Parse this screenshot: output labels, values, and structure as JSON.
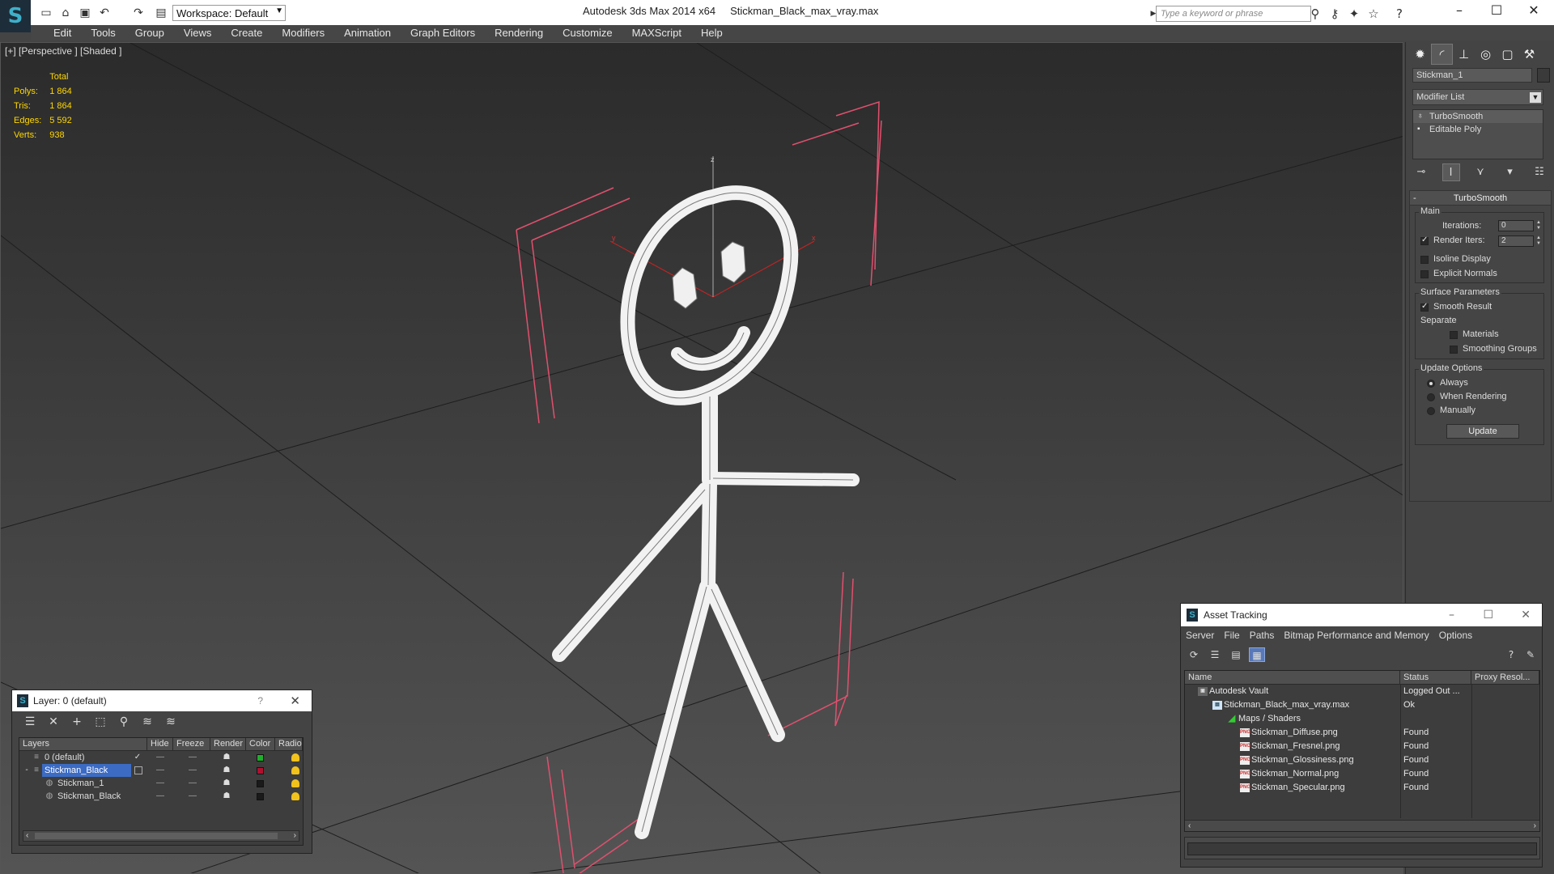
{
  "titlebar": {
    "workspace": "Workspace: Default",
    "app_title": "Autodesk 3ds Max  2014 x64",
    "file_name": "Stickman_Black_max_vray.max",
    "search_placeholder": "Type a keyword or phrase"
  },
  "menu": [
    "Edit",
    "Tools",
    "Group",
    "Views",
    "Create",
    "Modifiers",
    "Animation",
    "Graph Editors",
    "Rendering",
    "Customize",
    "MAXScript",
    "Help"
  ],
  "viewport": {
    "label": "[+] [Perspective ] [Shaded ]",
    "stats_header": "Total",
    "stats": [
      {
        "label": "Polys:",
        "value": "1 864"
      },
      {
        "label": "Tris:",
        "value": "1 864"
      },
      {
        "label": "Edges:",
        "value": "5 592"
      },
      {
        "label": "Verts:",
        "value": "938"
      }
    ],
    "gizmo": {
      "x": "x",
      "y": "y",
      "z": "z"
    }
  },
  "command_panel": {
    "object_name": "Stickman_1",
    "modifier_list": "Modifier List",
    "stack": [
      {
        "label": "TurboSmooth",
        "selected": true
      },
      {
        "label": "Editable Poly",
        "selected": false
      }
    ],
    "turbosmooth": {
      "title": "TurboSmooth",
      "main_group": "Main",
      "iterations_label": "Iterations:",
      "iterations_value": "0",
      "render_iters_label": "Render Iters:",
      "render_iters_value": "2",
      "render_iters_checked": true,
      "isoline_label": "Isoline Display",
      "isoline_checked": false,
      "explicit_normals_label": "Explicit Normals",
      "explicit_normals_checked": false,
      "surface_group": "Surface Parameters",
      "smooth_result_label": "Smooth Result",
      "smooth_result_checked": true,
      "separate_label": "Separate",
      "materials_label": "Materials",
      "materials_checked": false,
      "smoothing_groups_label": "Smoothing Groups",
      "smoothing_groups_checked": false,
      "update_group": "Update Options",
      "always_label": "Always",
      "when_rendering_label": "When Rendering",
      "manually_label": "Manually",
      "selected_update_option": "Always",
      "update_button": "Update"
    }
  },
  "layer_dialog": {
    "title": "Layer: 0 (default)",
    "help": "?",
    "columns": [
      "Layers",
      "Hide",
      "Freeze",
      "Render",
      "Color",
      "Radio"
    ],
    "rows": [
      {
        "name": "0 (default)",
        "color": "#1fae2c",
        "indent": 1,
        "selected": false,
        "current": true
      },
      {
        "name": "Stickman_Black",
        "color": "#b01030",
        "indent": 1,
        "selected": true,
        "current": false
      },
      {
        "name": "Stickman_1",
        "color": "#1a1a1a",
        "indent": 2,
        "selected": false,
        "current": false
      },
      {
        "name": "Stickman_Black",
        "color": "#1a1a1a",
        "indent": 2,
        "selected": false,
        "current": false
      }
    ]
  },
  "asset_tracking": {
    "title": "Asset Tracking",
    "menu": [
      "Server",
      "File",
      "Paths",
      "Bitmap Performance and Memory",
      "Options"
    ],
    "columns": [
      "Name",
      "Status",
      "Proxy Resol..."
    ],
    "rows": [
      {
        "name": "Autodesk Vault",
        "status": "Logged Out ...",
        "level": 0,
        "icon": "vault-icon"
      },
      {
        "name": "Stickman_Black_max_vray.max",
        "status": "Ok",
        "level": 1,
        "icon": "max-file-icon"
      },
      {
        "name": "Maps / Shaders",
        "status": "",
        "level": 2,
        "icon": "maps-icon"
      },
      {
        "name": "Stickman_Diffuse.png",
        "status": "Found",
        "level": 3,
        "icon": "png-icon"
      },
      {
        "name": "Stickman_Fresnel.png",
        "status": "Found",
        "level": 3,
        "icon": "png-icon"
      },
      {
        "name": "Stickman_Glossiness.png",
        "status": "Found",
        "level": 3,
        "icon": "png-icon"
      },
      {
        "name": "Stickman_Normal.png",
        "status": "Found",
        "level": 3,
        "icon": "png-icon"
      },
      {
        "name": "Stickman_Specular.png",
        "status": "Found",
        "level": 3,
        "icon": "png-icon"
      }
    ]
  },
  "colors": {
    "viewport_top": "#2b2b2b",
    "viewport_bottom": "#545454",
    "stats": "#ffd700",
    "selection_bracket": "#e0506e",
    "selected_layer": "#3c6bc4"
  }
}
